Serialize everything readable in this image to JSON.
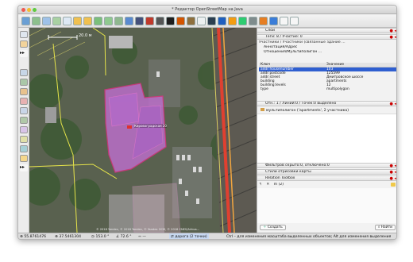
{
  "window": {
    "title": "* Редактор OpenStreetMap на Java"
  },
  "map": {
    "scale_label": "20.0 м",
    "building_label": "Кировоградская 20",
    "attribution": "© 2018 Yandex, © 2018 Yandex, © Yandex OCM, © 2018 CNES/Airbus..."
  },
  "panels": {
    "layers": {
      "title": "Слои"
    },
    "tags": {
      "title": "Теги: 8 / Участие: 0",
      "relation_row": "Участники / Участники (связанные здание ...",
      "annotation_row": "Аннотация/Адрес",
      "relation_group_row": "Отношения/Мультиполигон ...",
      "columns": {
        "key": "Ключ",
        "value": "Значение"
      },
      "rows": [
        {
          "key": "addr:housenumber",
          "value": "103"
        },
        {
          "key": "addr:postcode",
          "value": "125599"
        },
        {
          "key": "addr:street",
          "value": "Дмитровское шоссе"
        },
        {
          "key": "building",
          "value": "apartments"
        },
        {
          "key": "building:levels",
          "value": "12"
        },
        {
          "key": "type",
          "value": "multipolygon"
        }
      ]
    },
    "selection": {
      "title": "Отн.: 1 / Линий:0 / Точек:0 выделено",
      "item": "мультиполигон ('apartments', 2 участника)"
    },
    "filter": {
      "title": "Фильтров скрыто:0, отключено:0"
    },
    "styles": {
      "title": "Стили отрисовки карты"
    },
    "relation_toolbox": {
      "title": "Relation Toolbox",
      "field": "m (2)"
    },
    "bottom": {
      "create": "Создать",
      "find": "Найти"
    }
  },
  "statusbar": {
    "lat": "55.8761476",
    "lon": "37.5461304",
    "heading": "153.0 °",
    "angle": "72.6 °",
    "dist": "—",
    "way": "дорога (2 точки)",
    "hint": "Ctrl – для изменения масштаба выделенных объектов; Alt для изменения выделения"
  },
  "colors": {
    "building_fill": "#c06fd0",
    "selection": "#2f5fd0",
    "accent_road": "#e04030"
  },
  "icons": [
    "zoom-icon",
    "select-icon",
    "draw-icon",
    "delete-icon",
    "join-icon",
    "download-icon",
    "upload-icon",
    "undo-icon",
    "redo-icon",
    "preferences-icon",
    "help-icon"
  ]
}
